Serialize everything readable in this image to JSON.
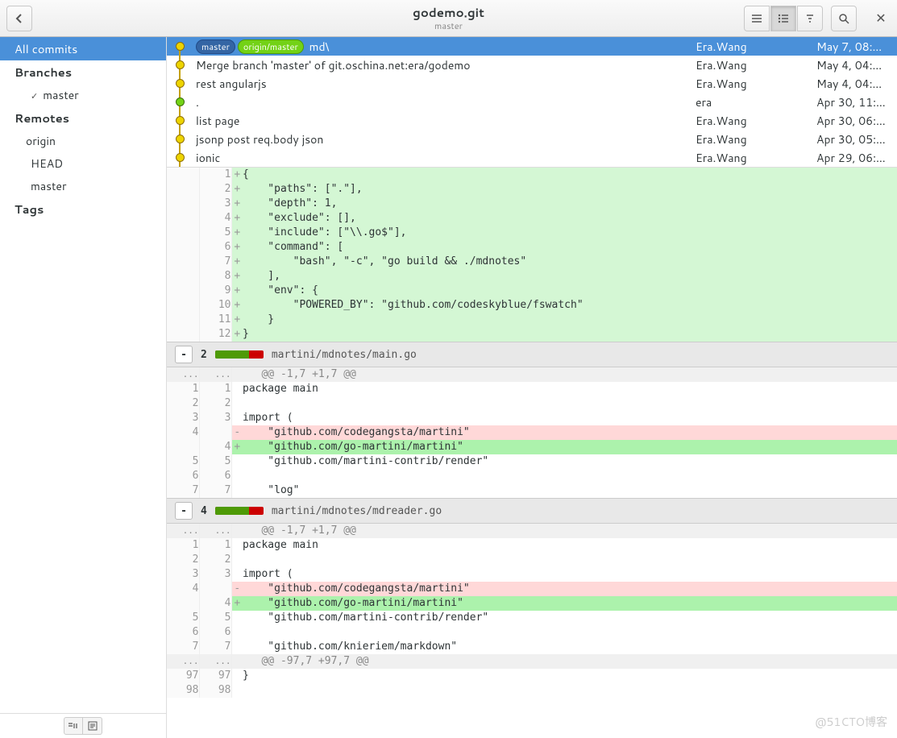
{
  "header": {
    "title": "godemo.git",
    "subtitle": "master"
  },
  "sidebar": {
    "all_commits": "All commits",
    "branches_label": "Branches",
    "branch_master": "master",
    "remotes_label": "Remotes",
    "remote_origin": "origin",
    "remote_head": "HEAD",
    "remote_master": "master",
    "tags_label": "Tags"
  },
  "badges": {
    "master": "master",
    "origin_master": "origin/master"
  },
  "commits": [
    {
      "msg": "md\\",
      "author": "Era.Wang",
      "date": "May 7, 08:…",
      "selected": true,
      "badges": true
    },
    {
      "msg": "Merge branch 'master' of git.oschina.net:era/godemo",
      "author": "Era.Wang",
      "date": "May 4, 04:…"
    },
    {
      "msg": "rest angularjs",
      "author": "Era.Wang",
      "date": "May 4, 04:…"
    },
    {
      "msg": ".",
      "author": "era",
      "date": "Apr 30, 11:…",
      "green": true
    },
    {
      "msg": "list page",
      "author": "Era.Wang",
      "date": "Apr 30, 06:…"
    },
    {
      "msg": "jsonp post req.body json",
      "author": "Era.Wang",
      "date": "Apr 30, 05:…"
    },
    {
      "msg": "ionic",
      "author": "Era.Wang",
      "date": "Apr 29, 06:…"
    }
  ],
  "diff": {
    "file1": {
      "lines": [
        {
          "n2": "1",
          "mark": "+",
          "code": "{"
        },
        {
          "n2": "2",
          "mark": "+",
          "code": "    \"paths\": [\".\"],"
        },
        {
          "n2": "3",
          "mark": "+",
          "code": "    \"depth\": 1,"
        },
        {
          "n2": "4",
          "mark": "+",
          "code": "    \"exclude\": [],"
        },
        {
          "n2": "5",
          "mark": "+",
          "code": "    \"include\": [\"\\\\.go$\"],"
        },
        {
          "n2": "6",
          "mark": "+",
          "code": "    \"command\": ["
        },
        {
          "n2": "7",
          "mark": "+",
          "code": "        \"bash\", \"-c\", \"go build && ./mdnotes\""
        },
        {
          "n2": "8",
          "mark": "+",
          "code": "    ],"
        },
        {
          "n2": "9",
          "mark": "+",
          "code": "    \"env\": {"
        },
        {
          "n2": "10",
          "mark": "+",
          "code": "        \"POWERED_BY\": \"github.com/codeskyblue/fswatch\""
        },
        {
          "n2": "11",
          "mark": "+",
          "code": "    }"
        },
        {
          "n2": "12",
          "mark": "+",
          "code": "}"
        }
      ]
    },
    "file2": {
      "count": "2",
      "path": "martini/mdnotes/main.go",
      "hunk": "@@ -1,7 +1,7 @@",
      "lines": [
        {
          "n1": "1",
          "n2": "1",
          "mark": "",
          "code": "package main",
          "cls": ""
        },
        {
          "n1": "2",
          "n2": "2",
          "mark": "",
          "code": "",
          "cls": ""
        },
        {
          "n1": "3",
          "n2": "3",
          "mark": "",
          "code": "import (",
          "cls": ""
        },
        {
          "n1": "4",
          "n2": "",
          "mark": "-",
          "code": "    \"github.com/codegangsta/martini\"",
          "cls": "del"
        },
        {
          "n1": "",
          "n2": "4",
          "mark": "+",
          "code": "    \"github.com/go-martini/martini\"",
          "cls": "add-strong"
        },
        {
          "n1": "5",
          "n2": "5",
          "mark": "",
          "code": "    \"github.com/martini-contrib/render\"",
          "cls": ""
        },
        {
          "n1": "6",
          "n2": "6",
          "mark": "",
          "code": "",
          "cls": ""
        },
        {
          "n1": "7",
          "n2": "7",
          "mark": "",
          "code": "    \"log\"",
          "cls": ""
        }
      ]
    },
    "file3": {
      "count": "4",
      "path": "martini/mdnotes/mdreader.go",
      "hunk1": "@@ -1,7 +1,7 @@",
      "lines1": [
        {
          "n1": "1",
          "n2": "1",
          "mark": "",
          "code": "package main",
          "cls": ""
        },
        {
          "n1": "2",
          "n2": "2",
          "mark": "",
          "code": "",
          "cls": ""
        },
        {
          "n1": "3",
          "n2": "3",
          "mark": "",
          "code": "import (",
          "cls": ""
        },
        {
          "n1": "4",
          "n2": "",
          "mark": "-",
          "code": "    \"github.com/codegangsta/martini\"",
          "cls": "del"
        },
        {
          "n1": "",
          "n2": "4",
          "mark": "+",
          "code": "    \"github.com/go-martini/martini\"",
          "cls": "add-strong"
        },
        {
          "n1": "5",
          "n2": "5",
          "mark": "",
          "code": "    \"github.com/martini-contrib/render\"",
          "cls": ""
        },
        {
          "n1": "6",
          "n2": "6",
          "mark": "",
          "code": "",
          "cls": ""
        },
        {
          "n1": "7",
          "n2": "7",
          "mark": "",
          "code": "    \"github.com/knieriem/markdown\"",
          "cls": ""
        }
      ],
      "hunk2": "@@ -97,7 +97,7 @@",
      "lines2": [
        {
          "n1": "97",
          "n2": "97",
          "mark": "",
          "code": "}",
          "cls": ""
        },
        {
          "n1": "98",
          "n2": "98",
          "mark": "",
          "code": "",
          "cls": ""
        }
      ]
    }
  },
  "watermark": "@51CTO博客"
}
